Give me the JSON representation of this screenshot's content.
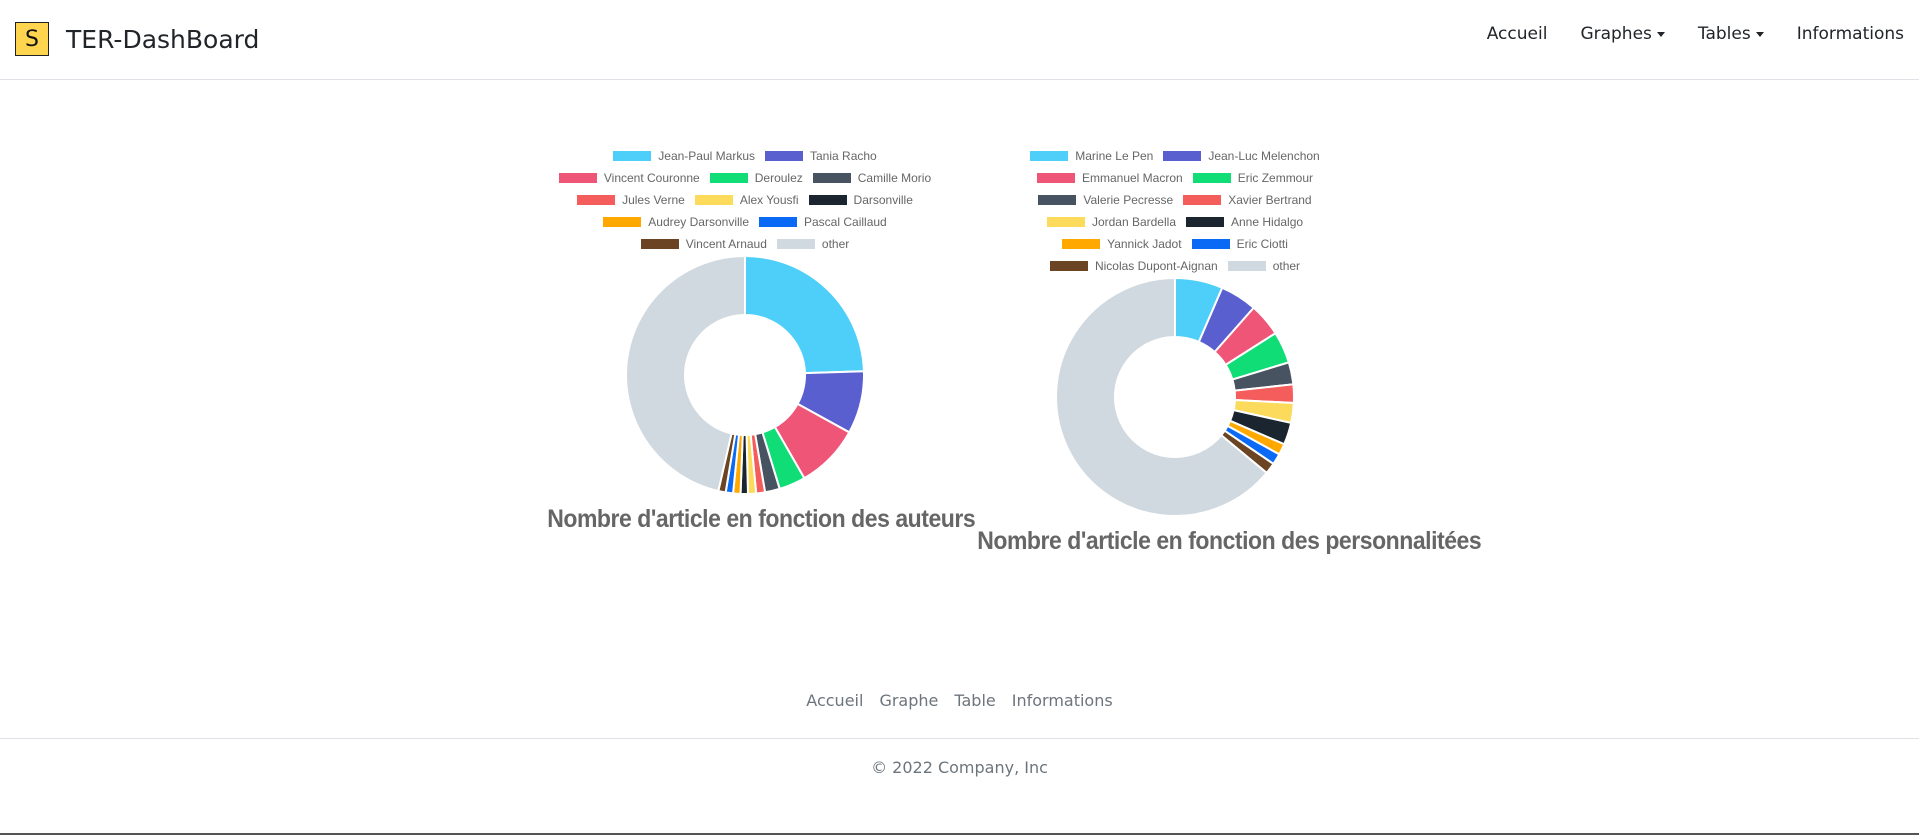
{
  "navbar": {
    "logo_letter": "S",
    "brand": "TER-DashBoard",
    "items": [
      {
        "label": "Accueil",
        "dropdown": false
      },
      {
        "label": "Graphes",
        "dropdown": true
      },
      {
        "label": "Tables",
        "dropdown": true
      },
      {
        "label": "Informations",
        "dropdown": false
      }
    ]
  },
  "chart_data": [
    {
      "type": "pie",
      "title": "Nombre d'article en fonction des auteurs",
      "legend_position": "top",
      "categories": [
        "Jean-Paul Markus",
        "Tania Racho",
        "Vincent Couronne",
        "Deroulez",
        "Camille Morio",
        "Jules Verne",
        "Alex Yousfi",
        "Darsonville",
        "Audrey Darsonville",
        "Pascal Caillaud",
        "Vincent Arnaud",
        "other"
      ],
      "values": [
        24.5,
        8.5,
        8.7,
        3.6,
        2.0,
        1.2,
        1.1,
        1.0,
        1.0,
        1.0,
        1.0,
        46.4
      ],
      "colors": [
        "#4dcff9",
        "#5a5fcf",
        "#ee5577",
        "#11dd77",
        "#475360",
        "#f55c5c",
        "#fcdb5c",
        "#1b2530",
        "#ffa800",
        "#0a6af5",
        "#6b4423",
        "#d1d9e0"
      ]
    },
    {
      "type": "pie",
      "title": "Nombre d'article en fonction des personnalitées",
      "legend_position": "top",
      "categories": [
        "Marine Le Pen",
        "Jean-Luc Melenchon",
        "Emmanuel Macron",
        "Eric Zemmour",
        "Valerie Pecresse",
        "Xavier Bertrand",
        "Jordan Bardella",
        "Anne Hidalgo",
        "Yannick Jadot",
        "Eric Ciotti",
        "Nicolas Dupont-Aignan",
        "other"
      ],
      "values": [
        6.5,
        5.0,
        4.5,
        4.3,
        3.0,
        2.5,
        2.7,
        3.0,
        1.5,
        1.5,
        1.5,
        64.0
      ],
      "colors": [
        "#4dcff9",
        "#5a5fcf",
        "#ee5577",
        "#11dd77",
        "#475360",
        "#f55c5c",
        "#fcdb5c",
        "#1b2530",
        "#ffa800",
        "#0a6af5",
        "#6b4423",
        "#d1d9e0"
      ]
    }
  ],
  "footer": {
    "links": [
      "Accueil",
      "Graphe",
      "Table",
      "Informations"
    ],
    "copyright": "© 2022 Company, Inc"
  }
}
